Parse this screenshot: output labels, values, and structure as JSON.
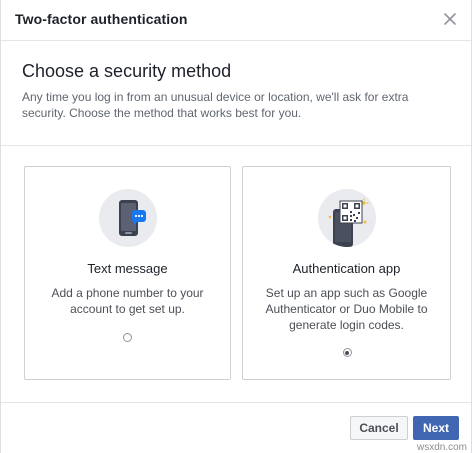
{
  "dialog": {
    "title": "Two-factor authentication",
    "close_icon": "close-icon"
  },
  "main": {
    "heading": "Choose a security method",
    "description": "Any time you log in from an unusual device or location, we'll ask for extra security. Choose the method that works best for you."
  },
  "options": [
    {
      "title": "Text message",
      "description": "Add a phone number to your account to get set up.",
      "icon": "phone-chat-icon",
      "selected": false
    },
    {
      "title": "Authentication app",
      "description": "Set up an app such as Google Authenticator or Duo Mobile to generate login codes.",
      "icon": "qr-phone-icon",
      "selected": true
    }
  ],
  "footer": {
    "cancel_label": "Cancel",
    "next_label": "Next"
  },
  "watermark": "wsxdn.com",
  "colors": {
    "primary": "#4267b2",
    "text_dark": "#1d2129",
    "text_muted": "#606770",
    "border": "#ccd0d5",
    "icon_bg": "#e9ebee",
    "chat_blue": "#1877f2",
    "sparkle_yellow": "#f7b928"
  }
}
